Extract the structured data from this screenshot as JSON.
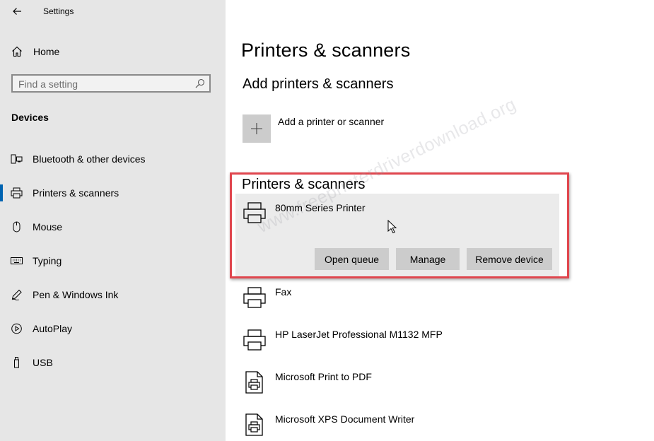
{
  "app": {
    "title": "Settings"
  },
  "sidebar": {
    "home_label": "Home",
    "search": {
      "placeholder": "Find a setting"
    },
    "section_heading": "Devices",
    "items": [
      {
        "label": "Bluetooth & other devices",
        "icon": "bluetooth-devices-icon",
        "selected": false
      },
      {
        "label": "Printers & scanners",
        "icon": "printer-icon",
        "selected": true
      },
      {
        "label": "Mouse",
        "icon": "mouse-icon",
        "selected": false
      },
      {
        "label": "Typing",
        "icon": "keyboard-icon",
        "selected": false
      },
      {
        "label": "Pen & Windows Ink",
        "icon": "pen-icon",
        "selected": false
      },
      {
        "label": "AutoPlay",
        "icon": "autoplay-icon",
        "selected": false
      },
      {
        "label": "USB",
        "icon": "usb-icon",
        "selected": false
      }
    ]
  },
  "main": {
    "page_title": "Printers & scanners",
    "add_section": {
      "heading": "Add printers & scanners",
      "add_label": "Add a printer or scanner"
    },
    "list_heading": "Printers & scanners",
    "printers": [
      {
        "name": "80mm Series Printer",
        "icon": "printer-icon",
        "selected": true
      },
      {
        "name": "Fax",
        "icon": "printer-icon",
        "selected": false
      },
      {
        "name": "HP LaserJet Professional M1132 MFP",
        "icon": "printer-icon",
        "selected": false
      },
      {
        "name": "Microsoft Print to PDF",
        "icon": "document-printer-icon",
        "selected": false
      },
      {
        "name": "Microsoft XPS Document Writer",
        "icon": "document-printer-icon",
        "selected": false
      }
    ],
    "actions": {
      "open_queue": "Open queue",
      "manage": "Manage",
      "remove_device": "Remove device"
    }
  },
  "watermark": "www.freeprinterdriverdownload.org",
  "colors": {
    "sidebar_bg": "#e6e6e6",
    "selection_bar": "#0063b1",
    "selected_item_bg": "#ebebeb",
    "button_bg": "#cccccc",
    "highlight_frame": "#e0464e"
  }
}
